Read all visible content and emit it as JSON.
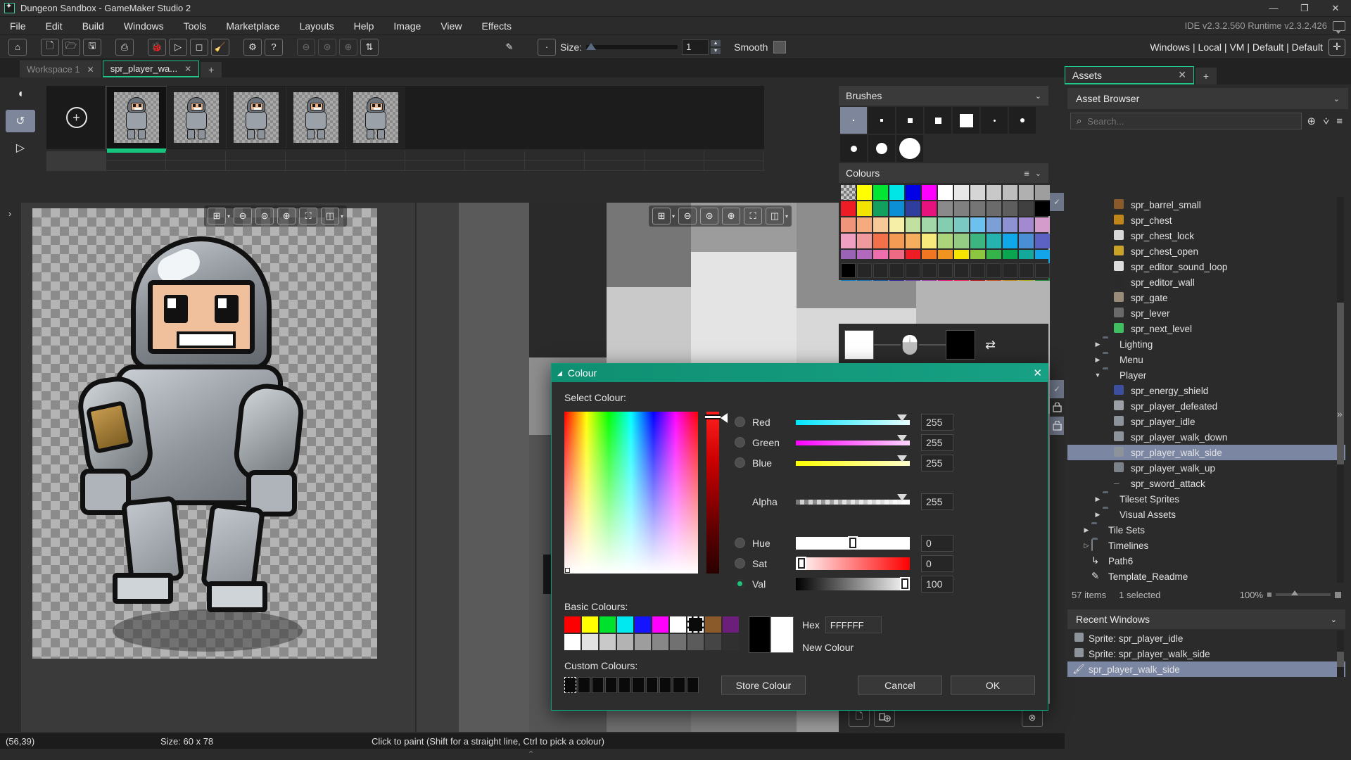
{
  "window": {
    "title": "Dungeon Sandbox - GameMaker Studio 2",
    "minimize": "—",
    "maximize": "❐",
    "close": "✕"
  },
  "menu": {
    "items": [
      "File",
      "Edit",
      "Build",
      "Windows",
      "Tools",
      "Marketplace",
      "Layouts",
      "Help",
      "Image",
      "View",
      "Effects"
    ],
    "version_info": "IDE v2.3.2.560  Runtime v2.3.2.426"
  },
  "toolbar": {
    "home": "⌂",
    "new": "🗋",
    "open": "🗁",
    "save": "🖫",
    "package": "⎙",
    "debug": "🐞",
    "run": "▷",
    "stop": "◻",
    "clean": "🧹",
    "prefs": "⚙",
    "help": "?",
    "zoom_out": "⊖",
    "zoom_fit": "⊜",
    "zoom_in": "⊕",
    "layout": "⇅",
    "pen_tool": "✎",
    "brush_preview": "·",
    "size_label": "Size:",
    "size_value": "1",
    "smooth_label": "Smooth",
    "target_text": "Windows | Local | VM | Default | Default",
    "target_icon": "✛"
  },
  "tabs": {
    "items": [
      {
        "label": "Workspace 1",
        "active": false
      },
      {
        "label": "spr_player_wa...",
        "active": true
      }
    ],
    "add": "+"
  },
  "frames": {
    "tools": [
      {
        "name": "onion-skin-icon",
        "glyph": "◖",
        "on": false
      },
      {
        "name": "loop-icon",
        "glyph": "↺",
        "on": true
      },
      {
        "name": "play-icon",
        "glyph": "▷",
        "on": false
      }
    ],
    "add_frame": "+",
    "count": 5,
    "selected_index": 0
  },
  "canvas": {
    "left_toolbar": [
      "grid-icon",
      "zoom-out-icon",
      "zoom-reset-icon",
      "zoom-in-icon",
      "fit-icon",
      "split-icon"
    ],
    "glyphs": {
      "grid": "⊞",
      "zoom_out": "⊖",
      "zoom_reset": "⊜",
      "zoom_in": "⊕",
      "fit": "⛶",
      "split": "◫",
      "caret": "▾"
    }
  },
  "brushes": {
    "title": "Brushes",
    "caret": "⌄",
    "squares": [
      1,
      3,
      5,
      7,
      13
    ],
    "circles": [
      1,
      3,
      5,
      9,
      17
    ],
    "selected": 0
  },
  "colours": {
    "title": "Colours",
    "burger": "≡",
    "caret": "⌄",
    "rows": [
      [
        "transparent",
        "#ffff00",
        "#00e633",
        "#00e6e6",
        "#0000e6",
        "#ff00ff",
        "#ffffff",
        "#e8e8e8",
        "#d6d6d6",
        "#c8c8c8",
        "#bdbdbd",
        "#b0b0b0",
        "#9e9e9e"
      ],
      [
        "#ee1c24",
        "#f2e400",
        "#11a05e",
        "#0d8fd6",
        "#2f3d9e",
        "#e8127e",
        "#8a8a8a",
        "#808080",
        "#757575",
        "#6b6b6b",
        "#5e5e5e",
        "#404040",
        "#000000"
      ],
      [
        "#f0947c",
        "#f5ab7e",
        "#f7c998",
        "#f6efa8",
        "#c2e0a0",
        "#a3d6a8",
        "#83cdb0",
        "#7bc9c3",
        "#6cc2ef",
        "#7d9fd8",
        "#8e92d2",
        "#a389cf",
        "#d49ccb"
      ],
      [
        "#efa0c2",
        "#f09a9e",
        "#f2714b",
        "#f39a55",
        "#f4ae5e",
        "#f7e97b",
        "#acd47a",
        "#94cc83",
        "#3db57f",
        "#24b3ae",
        "#10a8e8",
        "#4a8ed6",
        "#5b62c4"
      ],
      [
        "#9a63b5",
        "#b269bd",
        "#ef6fae",
        "#ef6a85",
        "#ee1c24",
        "#f07622",
        "#f0931f",
        "#f5e500",
        "#8dc63f",
        "#35b34a",
        "#0aa64f",
        "#12a89a",
        "#12a5ea"
      ],
      [
        "#0f7cc0",
        "#0d6fb8",
        "#0b52a0",
        "#2b2f96",
        "#6b3f9e",
        "#a13b9e",
        "#e8127e",
        "#ef2255",
        "#bd1420",
        "#c4541a",
        "#c08418",
        "#b3ad11",
        "#1e8a3d"
      ]
    ],
    "empty_row": 13
  },
  "fgbg": {
    "foreground": "#ffffff",
    "background": "#000000",
    "mouse_icon": "mouse-icon",
    "swap_icon": "⇄"
  },
  "dialog": {
    "title": "Colour",
    "collapse_glyph": "◢",
    "close": "✕",
    "select_label": "Select Colour:",
    "channels": [
      {
        "name": "Red",
        "value": "255",
        "selected": false,
        "track": "linear-gradient(to right,#00e5ff,#e8ffff)",
        "thumb": 96
      },
      {
        "name": "Green",
        "value": "255",
        "selected": false,
        "track": "linear-gradient(to right,#ff00ff,#ffd6ff)",
        "thumb": 96
      },
      {
        "name": "Blue",
        "value": "255",
        "selected": false,
        "track": "linear-gradient(to right,#ffff00,#ffffcc)",
        "thumb": 96
      }
    ],
    "alpha": {
      "name": "Alpha",
      "value": "255",
      "thumb": 96
    },
    "hsv": [
      {
        "name": "Hue",
        "value": "0",
        "selected": false,
        "track": "#ffffff",
        "thumb": 50
      },
      {
        "name": "Sat",
        "value": "0",
        "selected": false,
        "track": "linear-gradient(to right,#ffffff,#ff0000)",
        "thumb": 2
      },
      {
        "name": "Val",
        "value": "100",
        "selected": true,
        "track": "linear-gradient(to right,#000000,#ffffff)",
        "thumb": 95
      }
    ],
    "basic_label": "Basic Colours:",
    "basic_row1": [
      "#ff0000",
      "#ffff00",
      "#00e12e",
      "#00e9f0",
      "#1414ff",
      "#ff00ff",
      "#ffffff",
      "#0a0a0a",
      "#8a5a2b",
      "#6b1f7a"
    ],
    "basic_row2": [
      "#ffffff",
      "#e2e2e2",
      "#c9c9c9",
      "#b3b3b3",
      "#9d9d9d",
      "#878787",
      "#717171",
      "#5b5b5b",
      "#454545",
      "#303030"
    ],
    "basic_selected_index": 7,
    "custom_label": "Custom Colours:",
    "custom_count": 10,
    "custom_selected_index": 0,
    "hex_label": "Hex",
    "hex_value": "FFFFFF",
    "new_colour_label": "New Colour",
    "old_colour": "#000000",
    "new_colour": "#ffffff",
    "buttons": {
      "store": "Store Colour",
      "cancel": "Cancel",
      "ok": "OK"
    }
  },
  "assets": {
    "tab_label": "Assets",
    "tab_close": "✕",
    "tab_add": "+",
    "header": "Asset Browser",
    "header_caret": "⌄",
    "search_placeholder": "Search...",
    "search_value": "",
    "tool_add": "⊕",
    "tool_filter": "⩒",
    "tool_menu": "≡",
    "tree": [
      {
        "label": "spr_barrel_small",
        "indent": 3,
        "type": "sprite",
        "icon_color": "#8a5a2b",
        "twisty": "",
        "selected": false
      },
      {
        "label": "spr_chest",
        "indent": 3,
        "type": "sprite",
        "icon_color": "#c08418",
        "twisty": "",
        "selected": false
      },
      {
        "label": "spr_chest_lock",
        "indent": 3,
        "type": "sprite",
        "icon_color": "#d8d8d8",
        "twisty": "",
        "selected": false
      },
      {
        "label": "spr_chest_open",
        "indent": 3,
        "type": "sprite",
        "icon_color": "#c9a227",
        "twisty": "",
        "selected": false
      },
      {
        "label": "spr_editor_sound_loop",
        "indent": 3,
        "type": "sprite",
        "icon_color": "#dddddd",
        "twisty": "",
        "selected": false
      },
      {
        "label": "spr_editor_wall",
        "indent": 3,
        "type": "sprite",
        "icon_color": "#2a2a2a",
        "twisty": "",
        "selected": false
      },
      {
        "label": "spr_gate",
        "indent": 3,
        "type": "sprite",
        "icon_color": "#9a8a78",
        "twisty": "",
        "selected": false
      },
      {
        "label": "spr_lever",
        "indent": 3,
        "type": "sprite",
        "icon_color": "#6a6a6a",
        "twisty": "",
        "selected": false
      },
      {
        "label": "spr_next_level",
        "indent": 3,
        "type": "sprite",
        "icon_color": "#3fbf5f",
        "twisty": "",
        "selected": false
      },
      {
        "label": "Lighting",
        "indent": 2,
        "type": "folder",
        "twisty": "▶",
        "selected": false
      },
      {
        "label": "Menu",
        "indent": 2,
        "type": "folder",
        "twisty": "▶",
        "selected": false
      },
      {
        "label": "Player",
        "indent": 2,
        "type": "folder-open",
        "twisty": "▼",
        "selected": false
      },
      {
        "label": "spr_energy_shield",
        "indent": 3,
        "type": "sprite",
        "icon_color": "#3b4f9e",
        "twisty": "",
        "selected": false
      },
      {
        "label": "spr_player_defeated",
        "indent": 3,
        "type": "sprite",
        "icon_color": "#9aa0a6",
        "twisty": "",
        "selected": false
      },
      {
        "label": "spr_player_idle",
        "indent": 3,
        "type": "sprite",
        "icon_color": "#8d939a",
        "twisty": "",
        "selected": false
      },
      {
        "label": "spr_player_walk_down",
        "indent": 3,
        "type": "sprite",
        "icon_color": "#8d939a",
        "twisty": "",
        "selected": false
      },
      {
        "label": "spr_player_walk_side",
        "indent": 3,
        "type": "sprite",
        "icon_color": "#8d939a",
        "twisty": "",
        "selected": true
      },
      {
        "label": "spr_player_walk_up",
        "indent": 3,
        "type": "sprite",
        "icon_color": "#7b8188",
        "twisty": "",
        "selected": false
      },
      {
        "label": "spr_sword_attack",
        "indent": 3,
        "type": "sprite-empty",
        "icon_color": "#555555",
        "twisty": "",
        "selected": false
      },
      {
        "label": "Tileset Sprites",
        "indent": 2,
        "type": "folder",
        "twisty": "▶",
        "selected": false
      },
      {
        "label": "Visual Assets",
        "indent": 2,
        "type": "folder",
        "twisty": "▶",
        "selected": false
      },
      {
        "label": "Tile Sets",
        "indent": 1,
        "type": "folder",
        "twisty": "▶",
        "selected": false
      },
      {
        "label": "Timelines",
        "indent": 1,
        "type": "folder-empty",
        "twisty": "▷",
        "selected": false
      },
      {
        "label": "Path6",
        "indent": 1,
        "type": "path",
        "twisty": "",
        "selected": false
      },
      {
        "label": "Template_Readme",
        "indent": 1,
        "type": "note",
        "twisty": "",
        "selected": false
      }
    ],
    "status": {
      "items": "57 items",
      "selected": "1 selected",
      "zoom": "100%"
    },
    "recent_header": "Recent Windows",
    "recent_caret": "⌄",
    "recent": [
      {
        "label": "Sprite: spr_player_idle",
        "icon": "sprite-icon",
        "selected": false
      },
      {
        "label": "Sprite: spr_player_walk_side",
        "icon": "sprite-icon",
        "selected": false
      },
      {
        "label": "spr_player_walk_side",
        "icon": "brush-icon",
        "selected": true
      }
    ],
    "expand_glyph": "»"
  },
  "editor_rail": {
    "left_glyph": "›",
    "right_buttons": [
      {
        "name": "visibility-check",
        "glyph": "✓",
        "on": true
      },
      {
        "name": "visibility-check-2",
        "glyph": "✓",
        "on": true
      },
      {
        "name": "lock-closed",
        "glyph": "🔒",
        "on": false
      },
      {
        "name": "lock-open",
        "glyph": "🔓",
        "on": true
      }
    ]
  },
  "layer_buttons": {
    "new_layer": "🗋",
    "add_layer": "🗋⊕",
    "settings": "⊗"
  },
  "statusbar": {
    "coords": "(56,39)",
    "size": "Size: 60 x 78",
    "hint": "Click to paint (Shift for a straight line, Ctrl to pick a colour)",
    "chevron": "⌃"
  }
}
